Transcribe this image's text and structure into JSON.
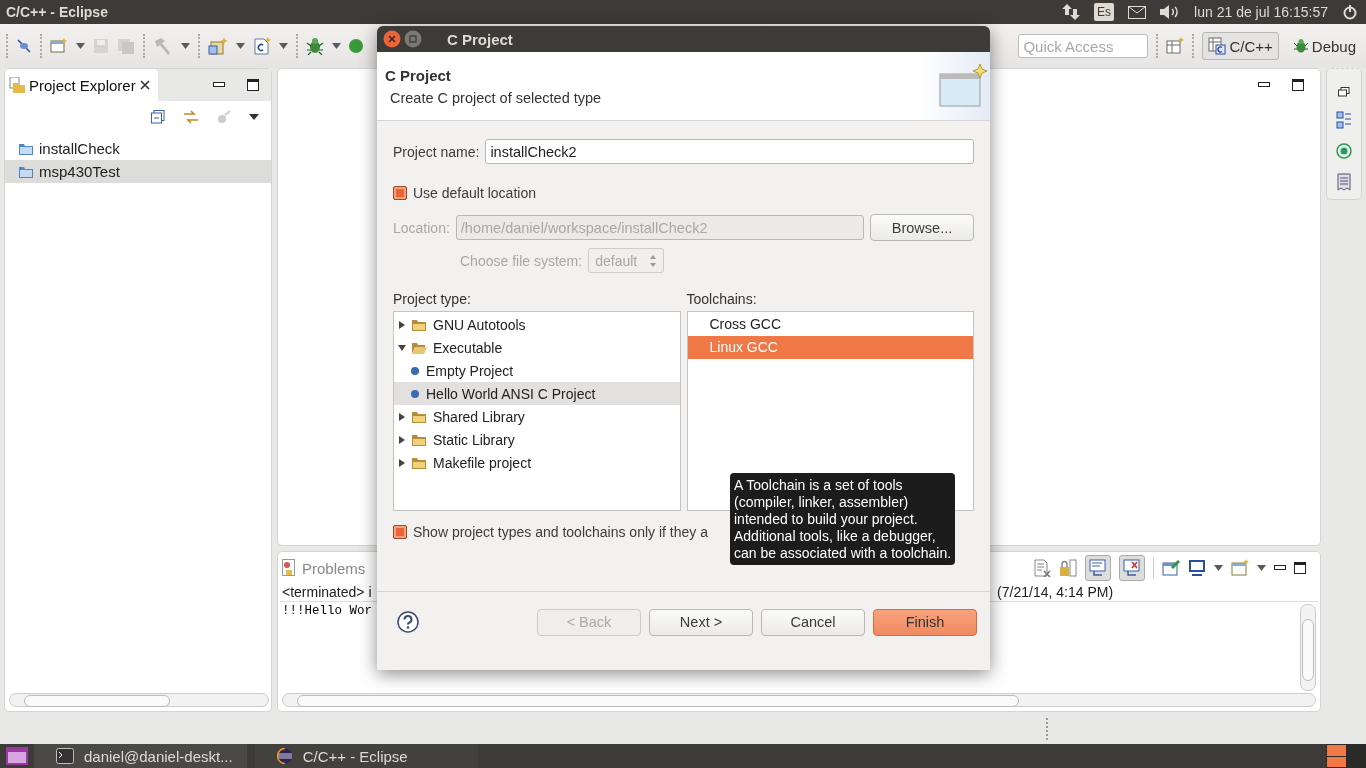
{
  "top_panel": {
    "title": "C/C++ - Eclipse",
    "keyboard_layout": "Es",
    "clock": "lun 21 de jul 16:15:57"
  },
  "toolbar": {
    "quick_access": {
      "placeholder": "Quick Access"
    },
    "perspectives": [
      {
        "label": "C/C++",
        "kind": "cpp",
        "selected": true
      },
      {
        "label": "Debug",
        "kind": "debug",
        "selected": false
      }
    ]
  },
  "project_explorer": {
    "title": "Project Explorer",
    "items": [
      {
        "label": "installCheck",
        "selected": false
      },
      {
        "label": "msp430Test",
        "selected": true
      }
    ]
  },
  "console": {
    "tab": "Problems",
    "header": "<terminated> i",
    "header_right": "(7/21/14, 4:14 PM)",
    "output": "!!!Hello Wor"
  },
  "dialog": {
    "window_title": "C Project",
    "heading": "C Project",
    "description": "Create C project of selected type",
    "project_name": {
      "label": "Project name:",
      "value": "installCheck2"
    },
    "use_default_location": {
      "label": "Use default location",
      "checked": true
    },
    "location": {
      "label": "Location:",
      "value": "/home/daniel/workspace/installCheck2",
      "disabled": true,
      "button": "Browse..."
    },
    "file_system": {
      "label": "Choose file system:",
      "value": "default",
      "disabled": true
    },
    "project_type": {
      "label": "Project type:",
      "items": [
        {
          "label": "GNU Autotools",
          "expanded": false,
          "selected": false
        },
        {
          "label": "Executable",
          "expanded": true,
          "selected": false,
          "children": [
            {
              "label": "Empty Project",
              "selected": false
            },
            {
              "label": "Hello World ANSI C Project",
              "selected": true
            }
          ]
        },
        {
          "label": "Shared Library",
          "expanded": false,
          "selected": false
        },
        {
          "label": "Static Library",
          "expanded": false,
          "selected": false
        },
        {
          "label": "Makefile project",
          "expanded": false,
          "selected": false
        }
      ]
    },
    "toolchains": {
      "label": "Toolchains:",
      "items": [
        {
          "label": "Cross GCC",
          "selected": false
        },
        {
          "label": "Linux GCC",
          "selected": true
        }
      ]
    },
    "show_supported": {
      "label": "Show project types and toolchains only if they a",
      "checked": true
    },
    "tooltip": [
      "A Toolchain is a set of tools",
      "(compiler, linker, assembler)",
      "intended to build your project.",
      "Additional tools, like a debugger,",
      "can be associated with a toolchain."
    ],
    "buttons": [
      {
        "label": "< Back",
        "kind": "normal",
        "disabled": true
      },
      {
        "label": "Next >",
        "kind": "normal",
        "disabled": false
      },
      {
        "label": "Cancel",
        "kind": "normal",
        "disabled": false
      },
      {
        "label": "Finish",
        "kind": "default",
        "disabled": false
      }
    ]
  },
  "taskbar": {
    "items": [
      {
        "label": "daniel@daniel-deskt...",
        "kind": "terminal"
      },
      {
        "label": "C/C++ - Eclipse",
        "kind": "eclipse"
      }
    ]
  }
}
